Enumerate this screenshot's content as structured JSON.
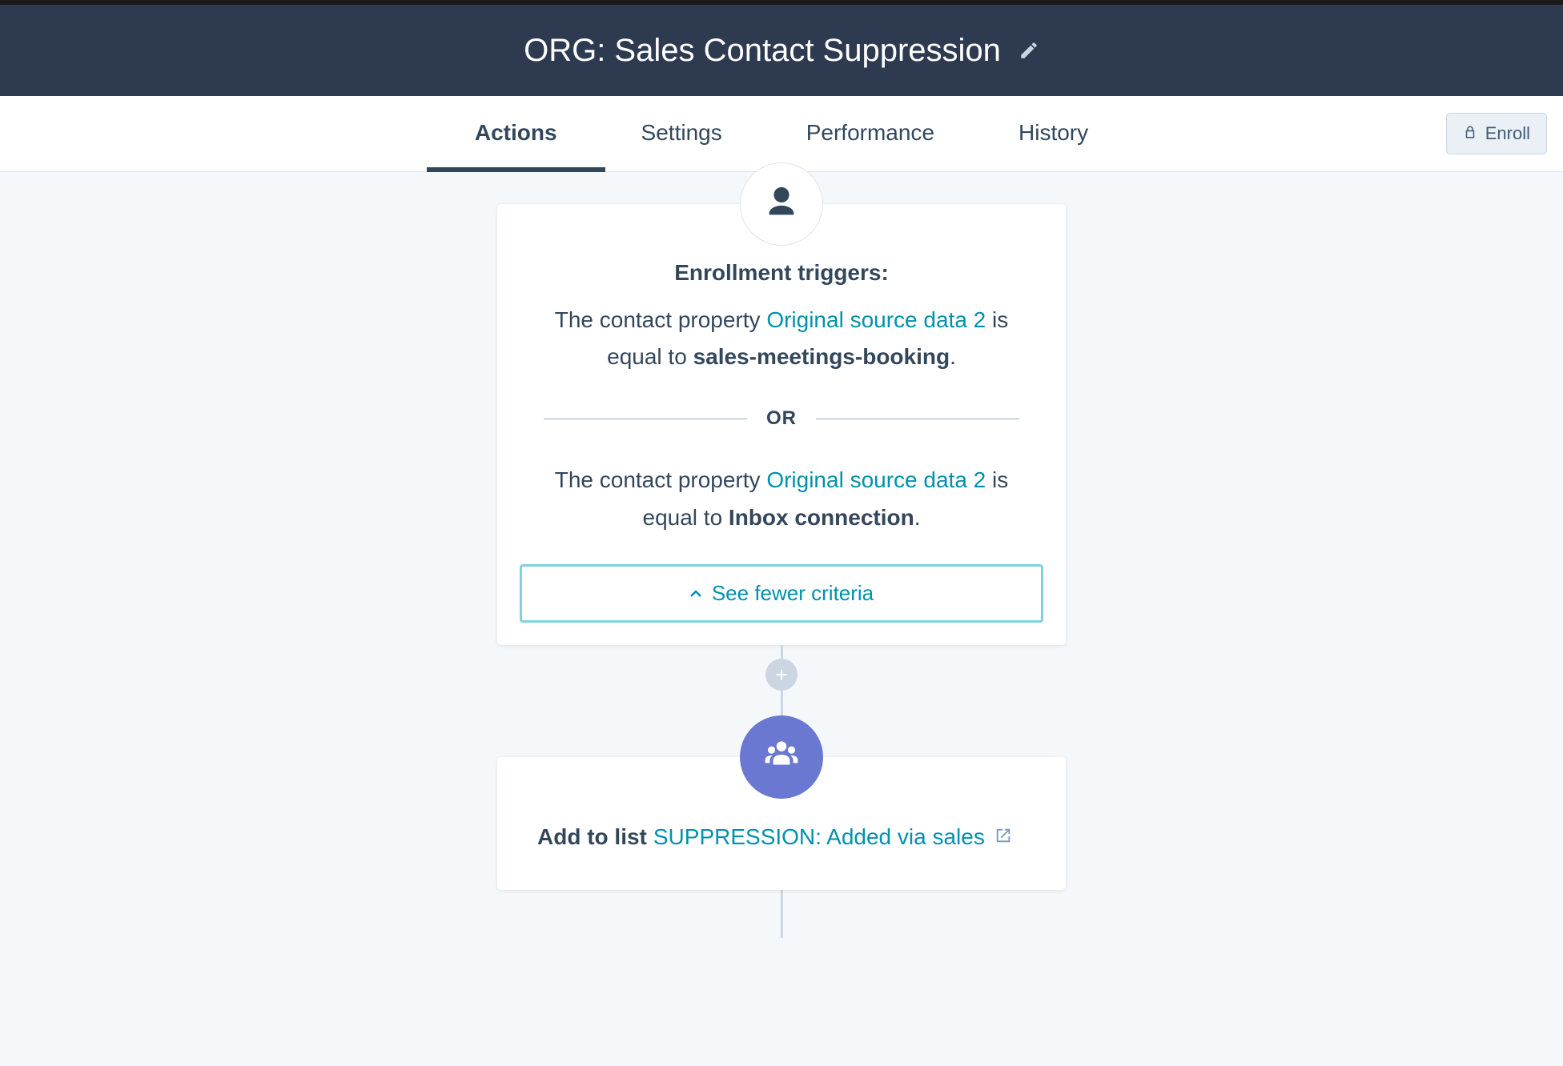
{
  "header": {
    "title": "ORG: Sales Contact Suppression"
  },
  "tabs": {
    "items": [
      "Actions",
      "Settings",
      "Performance",
      "History"
    ],
    "active_index": 0,
    "enroll_label": "Enroll"
  },
  "trigger_card": {
    "title": "Enrollment triggers:",
    "criteria": [
      {
        "prefix": "The contact property ",
        "link": "Original source data 2",
        "mid": " is equal to ",
        "value": "sales-meetings-booking",
        "suffix": "."
      },
      {
        "prefix": "The contact property ",
        "link": "Original source data 2",
        "mid": " is equal to ",
        "value": "Inbox connection",
        "suffix": "."
      }
    ],
    "or_label": "OR",
    "toggle_label": "See fewer criteria"
  },
  "add_button": {
    "glyph": "+"
  },
  "action_card": {
    "prefix": "Add to list",
    "list_name": "SUPPRESSION: Added via sales"
  }
}
